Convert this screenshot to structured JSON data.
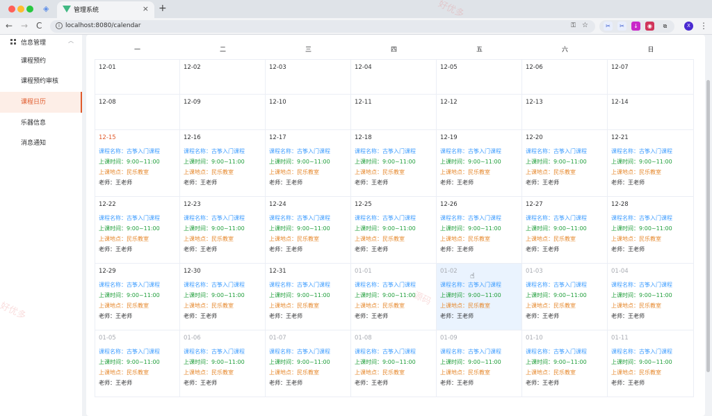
{
  "browser": {
    "tab_title": "管理系统",
    "tab_close": "×",
    "new_tab": "+",
    "url": "localhost:8080/calendar",
    "back": "←",
    "forward": "→",
    "reload": "C",
    "profile_initial": "X"
  },
  "sidebar": {
    "group_label": "信息管理",
    "items": [
      {
        "label": "课程预约",
        "active": false
      },
      {
        "label": "课程预约审核",
        "active": false
      },
      {
        "label": "课程日历",
        "active": true
      },
      {
        "label": "乐器信息",
        "active": false
      },
      {
        "label": "消息通知",
        "active": false
      }
    ]
  },
  "calendar": {
    "weekdays": [
      "一",
      "二",
      "三",
      "四",
      "五",
      "六",
      "日"
    ],
    "today": "12-15",
    "selected": "01-02",
    "event_labels": {
      "name_prefix": "课程名称：",
      "time_prefix": "上课时间：",
      "place_prefix": "上课地点：",
      "teacher_prefix": "老师："
    },
    "event": {
      "name": "古筝入门课程",
      "time": "9:00~11:00",
      "place": "民乐教室",
      "teacher": "王老师"
    },
    "weeks": [
      {
        "dates": [
          "12-01",
          "12-02",
          "12-03",
          "12-04",
          "12-05",
          "12-06",
          "12-07"
        ],
        "other": [],
        "has_events": false
      },
      {
        "dates": [
          "12-08",
          "12-09",
          "12-10",
          "12-11",
          "12-12",
          "12-13",
          "12-14"
        ],
        "other": [],
        "has_events": false
      },
      {
        "dates": [
          "12-15",
          "12-16",
          "12-17",
          "12-18",
          "12-19",
          "12-20",
          "12-21"
        ],
        "other": [],
        "has_events": true
      },
      {
        "dates": [
          "12-22",
          "12-23",
          "12-24",
          "12-25",
          "12-26",
          "12-27",
          "12-28"
        ],
        "other": [],
        "has_events": true
      },
      {
        "dates": [
          "12-29",
          "12-30",
          "12-31",
          "01-01",
          "01-02",
          "01-03",
          "01-04"
        ],
        "other": [
          "01-01",
          "01-02",
          "01-03",
          "01-04"
        ],
        "has_events": true
      },
      {
        "dates": [
          "01-05",
          "01-06",
          "01-07",
          "01-08",
          "01-09",
          "01-10",
          "01-11"
        ],
        "other": [
          "01-05",
          "01-06",
          "01-07",
          "01-08",
          "01-09",
          "01-10",
          "01-11"
        ],
        "has_events": true
      }
    ]
  },
  "watermarks": [
    "好优多",
    "好优多",
    "源码"
  ]
}
